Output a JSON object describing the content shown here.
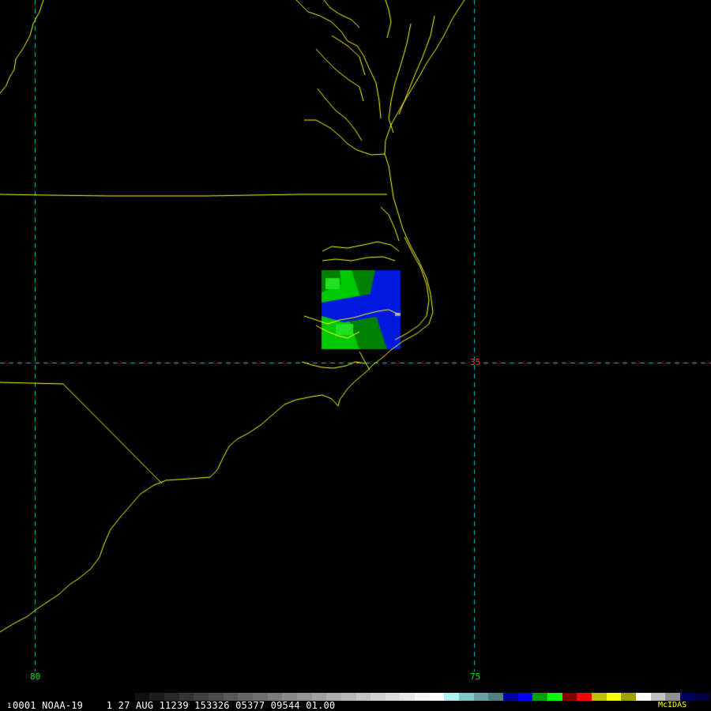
{
  "map": {
    "grid_labels": {
      "lon_80": "80",
      "lon_75": "75",
      "lat_35": "35"
    },
    "colors": {
      "background": "#000000",
      "coastline": "#ffff00",
      "grid": "#00c8c8",
      "lon_label": "#00e000",
      "lat_label": "#ff3030",
      "data_green_light": "#00c800",
      "data_green_dark": "#008000",
      "data_blue": "#0018e0"
    }
  },
  "status": {
    "frame_prefix": "1",
    "caption": "0001 NOAA-19    1 27 AUG 11239 153326 05377 09544 01.00",
    "brand": "McIDAS"
  },
  "colorbar": [
    "#000000",
    "#101010",
    "#1c1c1c",
    "#282828",
    "#343434",
    "#404040",
    "#4c4c4c",
    "#585858",
    "#646464",
    "#707070",
    "#7c7c7c",
    "#888888",
    "#949494",
    "#a0a0a0",
    "#acacac",
    "#b8b8b8",
    "#c4c4c4",
    "#d0d0d0",
    "#dcdcdc",
    "#e8e8e8",
    "#f4f4f4",
    "#ffffff",
    "#b0f0f0",
    "#80c8c8",
    "#6aa0a0",
    "#508080",
    "#0000a0",
    "#0000ff",
    "#00a000",
    "#00ff00",
    "#800000",
    "#ff0000",
    "#c0c000",
    "#ffff00",
    "#a0a000",
    "#ffffff",
    "#c0c0c0",
    "#909090",
    "#000060",
    "#000040"
  ]
}
